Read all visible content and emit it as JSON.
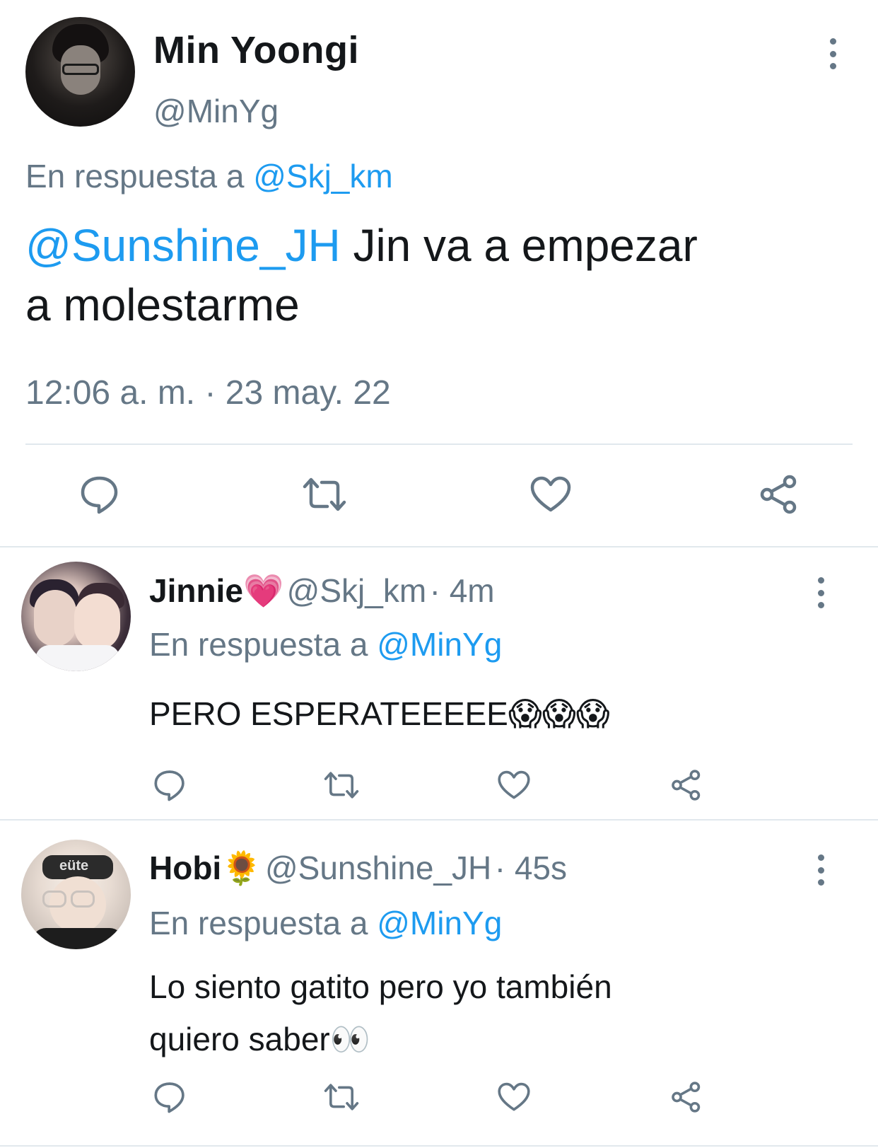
{
  "main_tweet": {
    "author_name": "Min Yoongi",
    "author_handle": "@MinYg",
    "reply_prefix": "En respuesta a",
    "reply_to": "@Skj_km",
    "mention": "@Sunshine_JH",
    "text_line1": " Jin va a empezar",
    "text_line2": "a molestarme",
    "timestamp": "12:06 a. m. · 23 may. 22"
  },
  "replies": [
    {
      "author_name": "Jinnie",
      "author_emoji": "💗",
      "author_handle": "@Skj_km",
      "time": "· 4m",
      "reply_prefix": "En respuesta a",
      "reply_to": "@MinYg",
      "text": "PERO ESPERATEEEEE",
      "text_emoji": "😱😱😱"
    },
    {
      "author_name": "Hobi",
      "author_emoji": "🌻",
      "author_handle": "@Sunshine_JH",
      "time": "· 45s",
      "reply_prefix": "En respuesta a",
      "reply_to": "@MinYg",
      "text_line1": "Lo siento gatito pero yo también",
      "text_line2": "quiero saber",
      "text_emoji": "👀"
    }
  ],
  "icons": {
    "reply": "reply-icon",
    "retweet": "retweet-icon",
    "like": "heart-icon",
    "share": "share-icon",
    "more": "more-vertical-icon"
  },
  "colors": {
    "link": "#1d9bf0",
    "muted": "#657786",
    "text": "#14171a",
    "divider": "#e1e8ed"
  }
}
